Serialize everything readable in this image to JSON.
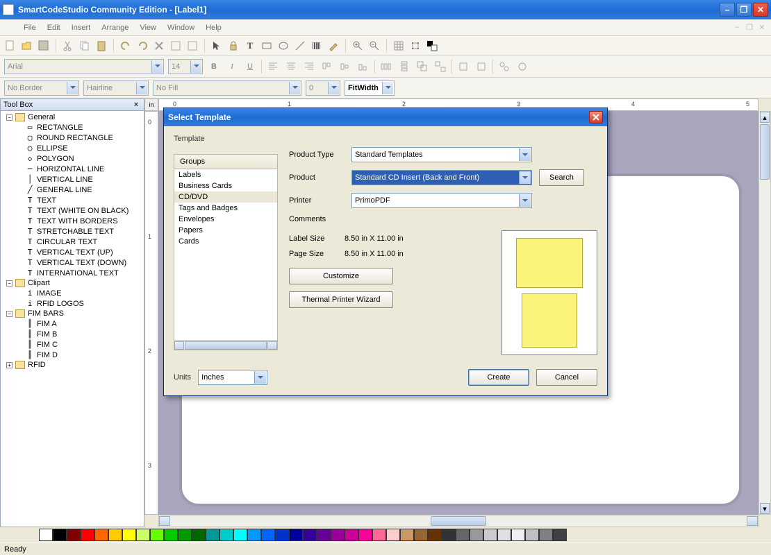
{
  "window": {
    "title": "SmartCodeStudio Community Edition - [Label1]"
  },
  "menu": {
    "file": "File",
    "edit": "Edit",
    "insert": "Insert",
    "arrange": "Arrange",
    "view": "View",
    "window": "Window",
    "help": "Help"
  },
  "font": {
    "name": "Arial",
    "size": "14"
  },
  "border": {
    "style": "No Border",
    "width": "Hairline",
    "fill": "No Fill",
    "fillpct": "0"
  },
  "zoom": {
    "mode": "FitWidth"
  },
  "toolbox": {
    "title": "Tool Box",
    "general": "General",
    "items_general": [
      "RECTANGLE",
      "ROUND RECTANGLE",
      "ELLIPSE",
      "POLYGON",
      "HORIZONTAL LINE",
      "VERTICAL LINE",
      "GENERAL LINE",
      "TEXT",
      "TEXT (WHITE ON BLACK)",
      "TEXT WITH BORDERS",
      "STRETCHABLE TEXT",
      "CIRCULAR TEXT",
      "VERTICAL TEXT (UP)",
      "VERTICAL TEXT (DOWN)",
      "INTERNATIONAL TEXT"
    ],
    "clipart": "Clipart",
    "items_clipart": [
      "IMAGE",
      "RFID LOGOS"
    ],
    "fimbars": "FIM BARS",
    "items_fim": [
      "FIM A",
      "FIM B",
      "FIM C",
      "FIM D"
    ],
    "rfid": "RFID"
  },
  "ruler": {
    "unit": "in",
    "h_numbers": [
      "0",
      "1",
      "2",
      "3",
      "4",
      "5"
    ],
    "v_numbers": [
      "0",
      "1",
      "2",
      "3"
    ]
  },
  "dialog": {
    "title": "Select Template",
    "template_lbl": "Template",
    "groups_lbl": "Groups",
    "groups": [
      "Labels",
      "Business Cards",
      "CD/DVD",
      "Tags and Badges",
      "Envelopes",
      "Papers",
      "Cards"
    ],
    "product_type_lbl": "Product Type",
    "product_type": "Standard Templates",
    "product_lbl": "Product",
    "product": "Standard CD Insert (Back and Front)",
    "printer_lbl": "Printer",
    "printer": "PrimoPDF",
    "comments_lbl": "Comments",
    "label_size_lbl": "Label Size",
    "label_size": "8.50 in X 11.00 in",
    "page_size_lbl": "Page Size",
    "page_size": "8.50 in X 11.00 in",
    "customize": "Customize",
    "thermal": "Thermal Printer Wizard",
    "search": "Search",
    "units_lbl": "Units",
    "units": "Inches",
    "create": "Create",
    "cancel": "Cancel"
  },
  "status": {
    "text": "Ready"
  },
  "colors": [
    "#ffffff",
    "#000000",
    "#800000",
    "#ff0000",
    "#ff6600",
    "#ffcc00",
    "#ffff00",
    "#ccff66",
    "#66ff00",
    "#00cc00",
    "#009900",
    "#006600",
    "#009999",
    "#00cccc",
    "#00ffff",
    "#0099ff",
    "#0066ff",
    "#0033cc",
    "#000099",
    "#330099",
    "#660099",
    "#990099",
    "#cc0099",
    "#ff0099",
    "#ff6699",
    "#ffcccc",
    "#cc9966",
    "#996633",
    "#663300",
    "#333333",
    "#666666",
    "#999999",
    "#cccccc",
    "#e0e0e0",
    "#f0f0f0",
    "#c0c0c0",
    "#808080",
    "#404040"
  ]
}
